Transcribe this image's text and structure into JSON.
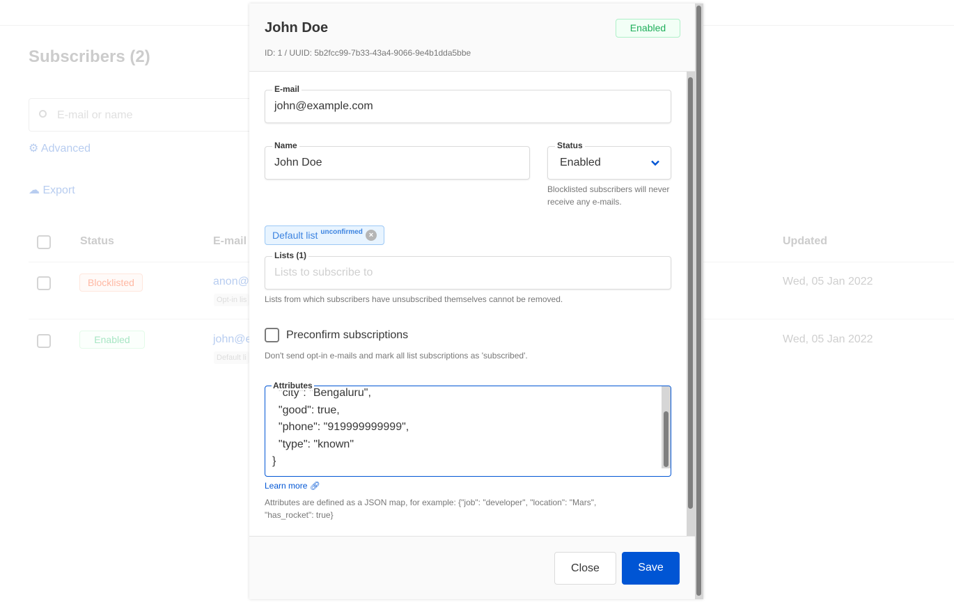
{
  "background": {
    "title": "Subscribers (2)",
    "search_placeholder": "E-mail or name",
    "advanced": "Advanced",
    "export": "Export",
    "columns": {
      "status": "Status",
      "email": "E-mail",
      "updated": "Updated"
    },
    "rows": [
      {
        "status": "Blocklisted",
        "email": "anon@",
        "list": "Opt-in lis",
        "updated": "Wed, 05 Jan 2022"
      },
      {
        "status": "Enabled",
        "email": "john@e",
        "list": "Default li",
        "updated": "Wed, 05 Jan 2022"
      }
    ]
  },
  "modal": {
    "name": "John Doe",
    "status_badge": "Enabled",
    "id_line": "ID: 1 / UUID: 5b2fcc99-7b33-43a4-9066-9e4b1dda5bbe",
    "email_label": "E-mail",
    "email_value": "john@example.com",
    "name_label": "Name",
    "name_value": "John Doe",
    "status_label": "Status",
    "status_value": "Enabled",
    "status_help": "Blocklisted subscribers will never receive any e-mails.",
    "list_chip": "Default list",
    "list_chip_sup": "unconfirmed",
    "lists_label": "Lists (1)",
    "lists_placeholder": "Lists to subscribe to",
    "lists_help": "Lists from which subscribers have unsubscribed themselves cannot be removed.",
    "preconfirm_label": "Preconfirm subscriptions",
    "preconfirm_help": "Don't send opt-in e-mails and mark all list subscriptions as 'subscribed'.",
    "attributes_label": "Attributes",
    "attributes_value": "  \"city\": \"Bengaluru\",\n  \"good\": true,\n  \"phone\": \"919999999999\",\n  \"type\": \"known\"\n}",
    "learn_more": "Learn more",
    "attributes_help": "Attributes are defined as a JSON map, for example: {\"job\": \"developer\", \"location\": \"Mars\", \"has_rocket\": true}",
    "close": "Close",
    "save": "Save"
  },
  "colors": {
    "primary": "#0055d4",
    "success": "#1fae5b",
    "danger": "#ff5722"
  }
}
